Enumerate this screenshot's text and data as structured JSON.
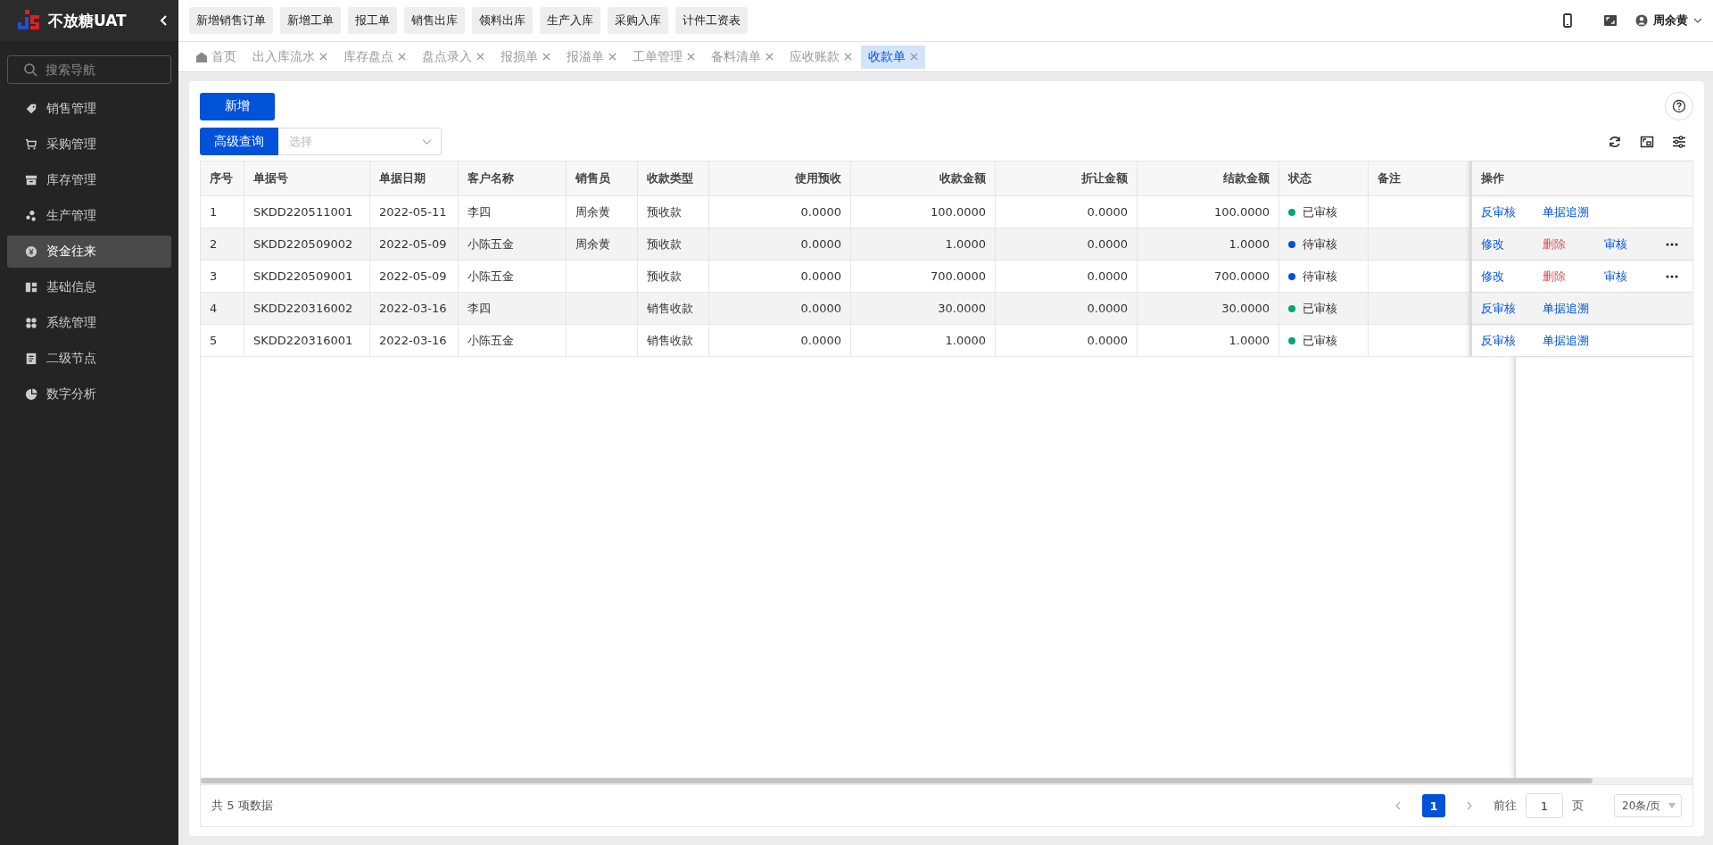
{
  "app": {
    "name": "不放糖UAT"
  },
  "sidebar": {
    "search_placeholder": "搜索导航",
    "items": [
      {
        "label": "销售管理",
        "selected": false
      },
      {
        "label": "采购管理",
        "selected": false
      },
      {
        "label": "库存管理",
        "selected": false
      },
      {
        "label": "生产管理",
        "selected": false
      },
      {
        "label": "资金往来",
        "selected": true
      },
      {
        "label": "基础信息",
        "selected": false
      },
      {
        "label": "系统管理",
        "selected": false
      },
      {
        "label": "二级节点",
        "selected": false
      },
      {
        "label": "数字分析",
        "selected": false
      }
    ]
  },
  "quick_actions": [
    "新增销售订单",
    "新增工单",
    "报工单",
    "销售出库",
    "领料出库",
    "生产入库",
    "采购入库",
    "计件工资表"
  ],
  "user": {
    "name": "周余黄"
  },
  "tabs": [
    {
      "label": "首页",
      "kind": "home",
      "selected": false
    },
    {
      "label": "出入库流水",
      "kind": "closable",
      "selected": false
    },
    {
      "label": "库存盘点",
      "kind": "closable",
      "selected": false
    },
    {
      "label": "盘点录入",
      "kind": "closable",
      "selected": false
    },
    {
      "label": "报损单",
      "kind": "closable",
      "selected": false
    },
    {
      "label": "报溢单",
      "kind": "closable",
      "selected": false
    },
    {
      "label": "工单管理",
      "kind": "closable",
      "selected": false
    },
    {
      "label": "备料清单",
      "kind": "closable",
      "selected": false
    },
    {
      "label": "应收账款",
      "kind": "closable",
      "selected": false
    },
    {
      "label": "收款单",
      "kind": "closable",
      "selected": true
    }
  ],
  "toolbar": {
    "add_button": "新增",
    "advanced_search_button": "高级查询",
    "select_placeholder": "选择"
  },
  "table": {
    "columns": [
      {
        "label": "序号"
      },
      {
        "label": "单据号"
      },
      {
        "label": "单据日期"
      },
      {
        "label": "客户名称"
      },
      {
        "label": "销售员"
      },
      {
        "label": "收款类型"
      },
      {
        "label": "使用预收"
      },
      {
        "label": "收款金额"
      },
      {
        "label": "折让金额"
      },
      {
        "label": "结款金额"
      },
      {
        "label": "状态"
      },
      {
        "label": "备注"
      },
      {
        "label": "操作"
      }
    ],
    "rows": [
      {
        "cells": [
          "1",
          "SKDD220511001",
          "2022-05-11",
          "李四",
          "周余黄",
          "预收款",
          "0.0000",
          "100.0000",
          "0.0000",
          "100.0000"
        ],
        "status": "已审核",
        "color": "#00a870",
        "note": "",
        "actions": [
          {
            "label": "反审核",
            "kind": "link"
          },
          {
            "label": "单据追溯",
            "kind": "link"
          }
        ]
      },
      {
        "cells": [
          "2",
          "SKDD220509002",
          "2022-05-09",
          "小陈五金",
          "周余黄",
          "预收款",
          "0.0000",
          "1.0000",
          "0.0000",
          "1.0000"
        ],
        "status": "待审核",
        "color": "#0052d9",
        "note": "",
        "actions": [
          {
            "label": "修改",
            "kind": "link"
          },
          {
            "label": "删除",
            "kind": "danger"
          },
          {
            "label": "审核",
            "kind": "link"
          },
          {
            "kind": "more"
          }
        ]
      },
      {
        "cells": [
          "3",
          "SKDD220509001",
          "2022-05-09",
          "小陈五金",
          "",
          "预收款",
          "0.0000",
          "700.0000",
          "0.0000",
          "700.0000"
        ],
        "status": "待审核",
        "color": "#0052d9",
        "note": "",
        "actions": [
          {
            "label": "修改",
            "kind": "link"
          },
          {
            "label": "删除",
            "kind": "danger"
          },
          {
            "label": "审核",
            "kind": "link"
          },
          {
            "kind": "more"
          }
        ]
      },
      {
        "cells": [
          "4",
          "SKDD220316002",
          "2022-03-16",
          "李四",
          "",
          "销售收款",
          "0.0000",
          "30.0000",
          "0.0000",
          "30.0000"
        ],
        "status": "已审核",
        "color": "#00a870",
        "note": "",
        "actions": [
          {
            "label": "反审核",
            "kind": "link"
          },
          {
            "label": "单据追溯",
            "kind": "link"
          }
        ]
      },
      {
        "cells": [
          "5",
          "SKDD220316001",
          "2022-03-16",
          "小陈五金",
          "",
          "销售收款",
          "0.0000",
          "1.0000",
          "0.0000",
          "1.0000"
        ],
        "status": "已审核",
        "color": "#00a870",
        "note": "",
        "actions": [
          {
            "label": "反审核",
            "kind": "link"
          },
          {
            "label": "单据追溯",
            "kind": "link"
          }
        ]
      }
    ]
  },
  "pagination": {
    "total": "共 5 项数据",
    "pages": [
      {
        "label": "1",
        "selected": true
      }
    ],
    "goto_label": "前往",
    "goto_value": "1",
    "page_suffix": "页",
    "page_size": "20条/页"
  }
}
